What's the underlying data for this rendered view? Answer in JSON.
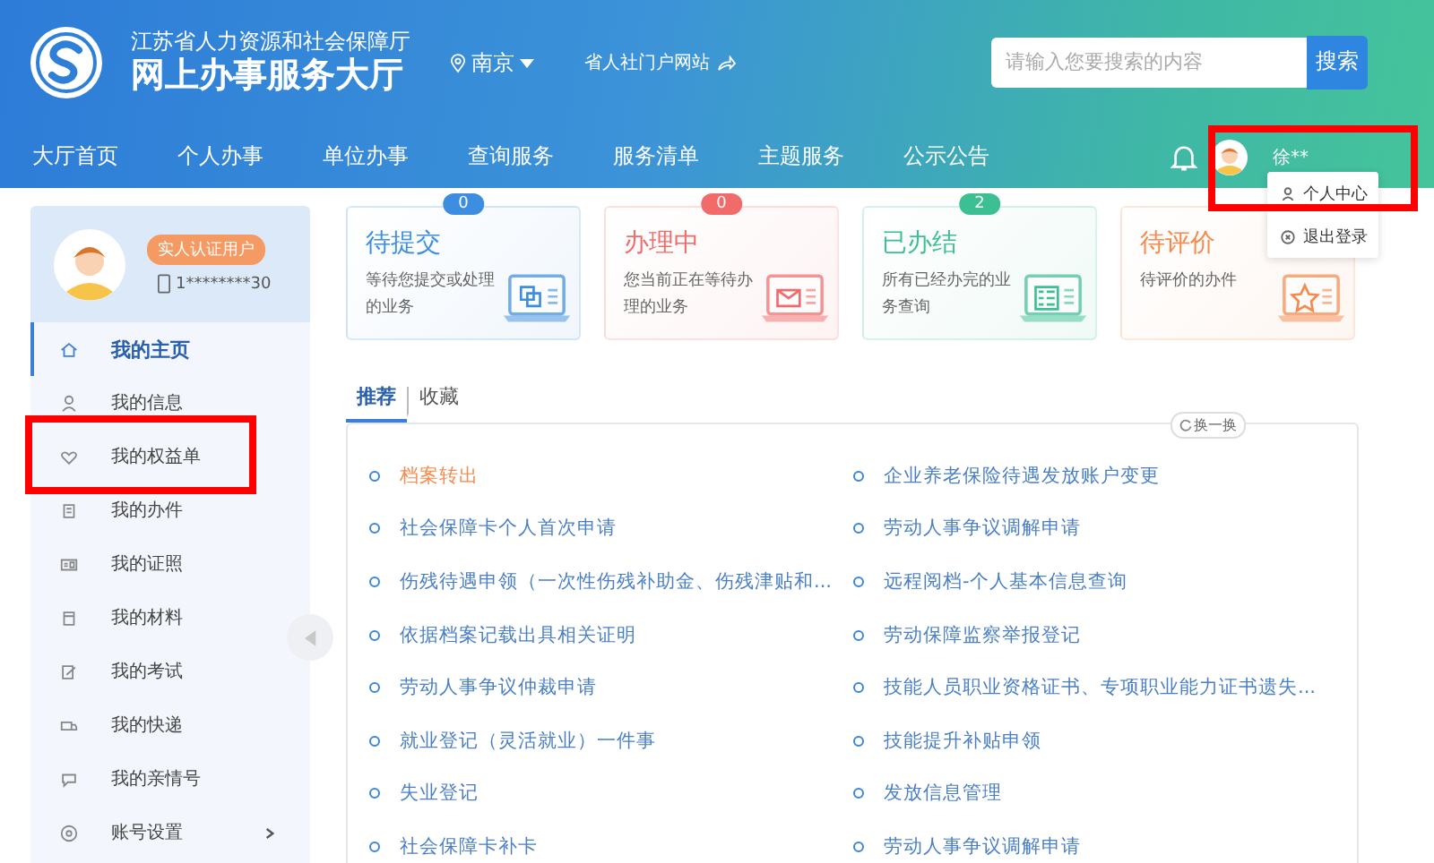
{
  "header": {
    "org": "江苏省人力资源和社会保障厅",
    "title": "网上办事服务大厅",
    "city": "南京",
    "portal_link": "省人社门户网站",
    "search": {
      "placeholder": "请输入您要搜索的内容",
      "button": "搜索"
    }
  },
  "nav": [
    {
      "label": "大厅首页"
    },
    {
      "label": "个人办事"
    },
    {
      "label": "单位办事"
    },
    {
      "label": "查询服务"
    },
    {
      "label": "服务清单"
    },
    {
      "label": "主题服务"
    },
    {
      "label": "公示公告"
    }
  ],
  "user": {
    "name": "徐**",
    "highlighted": true,
    "menu": [
      {
        "label": "个人中心"
      },
      {
        "label": "退出登录"
      }
    ]
  },
  "profile": {
    "badge": "实人认证用户",
    "phone": "1********30"
  },
  "sidebar": [
    {
      "label": "我的主页",
      "selected": true,
      "highlighted": false,
      "expandable": false
    },
    {
      "label": "我的信息",
      "selected": false,
      "highlighted": false,
      "expandable": false
    },
    {
      "label": "我的权益单",
      "selected": false,
      "highlighted": true,
      "expandable": false
    },
    {
      "label": "我的办件",
      "selected": false,
      "highlighted": false,
      "expandable": false
    },
    {
      "label": "我的证照",
      "selected": false,
      "highlighted": false,
      "expandable": false
    },
    {
      "label": "我的材料",
      "selected": false,
      "highlighted": false,
      "expandable": false
    },
    {
      "label": "我的考试",
      "selected": false,
      "highlighted": false,
      "expandable": false
    },
    {
      "label": "我的快递",
      "selected": false,
      "highlighted": false,
      "expandable": false
    },
    {
      "label": "我的亲情号",
      "selected": false,
      "highlighted": false,
      "expandable": false
    },
    {
      "label": "账号设置",
      "selected": false,
      "highlighted": false,
      "expandable": true
    }
  ],
  "status_cards": [
    {
      "title": "待提交",
      "desc": "等待您提交或处理的业务",
      "count": "0",
      "color": "#3d8ee0"
    },
    {
      "title": "办理中",
      "desc": "您当前正在等待办理的业务",
      "count": "0",
      "color": "#f26b6b"
    },
    {
      "title": "已办结",
      "desc": "所有已经办完的业务查询",
      "count": "2",
      "color": "#3dbf94"
    },
    {
      "title": "待评价",
      "desc": "待评价的办件",
      "color": "#f58a4c"
    }
  ],
  "tabs": [
    {
      "label": "推荐",
      "selected": true
    },
    {
      "label": "收藏",
      "selected": false
    }
  ],
  "refresh": "换一换",
  "services": [
    {
      "label": "档案转出",
      "hot": true
    },
    {
      "label": "企业养老保险待遇发放账户变更",
      "hot": false
    },
    {
      "label": "社会保障卡个人首次申请",
      "hot": false
    },
    {
      "label": "劳动人事争议调解申请",
      "hot": false
    },
    {
      "label": "伤残待遇申领（一次性伤残补助金、伤残津贴和...",
      "hot": false
    },
    {
      "label": "远程阅档-个人基本信息查询",
      "hot": false
    },
    {
      "label": "依据档案记载出具相关证明",
      "hot": false
    },
    {
      "label": "劳动保障监察举报登记",
      "hot": false
    },
    {
      "label": "劳动人事争议仲裁申请",
      "hot": false
    },
    {
      "label": "技能人员职业资格证书、专项职业能力证书遗失...",
      "hot": false
    },
    {
      "label": "就业登记（灵活就业）一件事",
      "hot": false
    },
    {
      "label": "技能提升补贴申领",
      "hot": false
    },
    {
      "label": "失业登记",
      "hot": false
    },
    {
      "label": "发放信息管理",
      "hot": false
    },
    {
      "label": "社会保障卡补卡",
      "hot": false
    },
    {
      "label": "劳动人事争议调解申请",
      "hot": false
    }
  ]
}
